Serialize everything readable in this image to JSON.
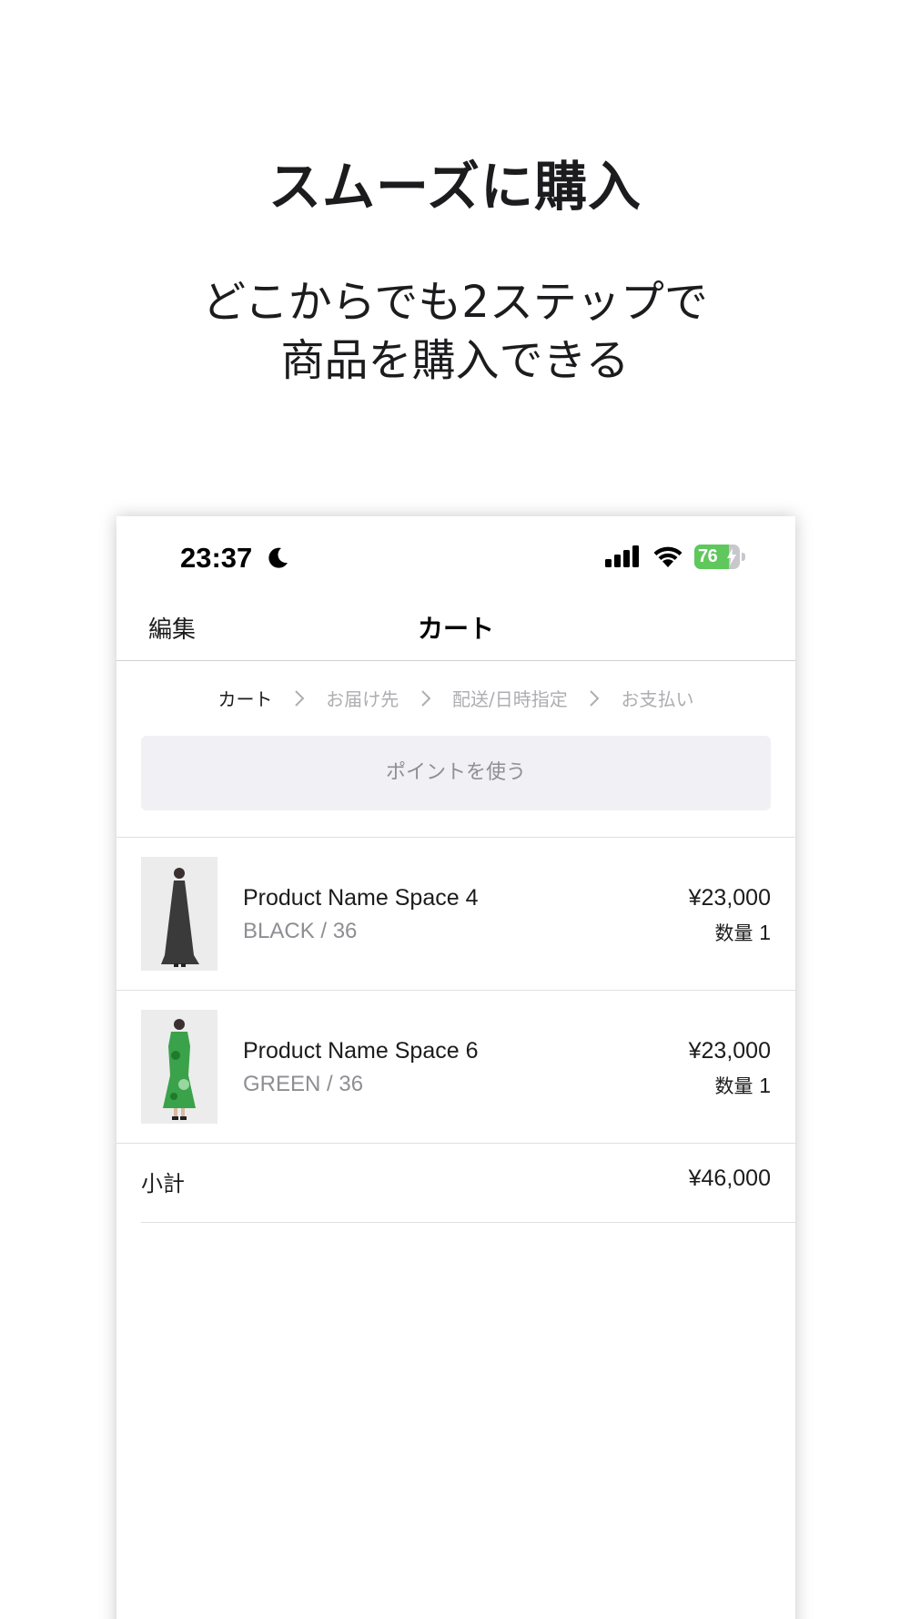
{
  "promo": {
    "title": "スムーズに購入",
    "subtitle_line1": "どこからでも2ステップで",
    "subtitle_line2": "商品を購入できる"
  },
  "status_bar": {
    "time": "23:37",
    "battery_level": "76",
    "battery_fraction": 0.76,
    "battery_color": "#5fc75c",
    "icons": [
      "moon-icon",
      "signal-icon",
      "wifi-icon",
      "battery-icon"
    ]
  },
  "nav": {
    "edit_label": "編集",
    "title": "カート"
  },
  "steps": [
    {
      "label": "カート",
      "active": true
    },
    {
      "label": "お届け先",
      "active": false
    },
    {
      "label": "配送/日時指定",
      "active": false
    },
    {
      "label": "お支払い",
      "active": false
    }
  ],
  "points_button_label": "ポイントを使う",
  "cart_items": [
    {
      "name": "Product Name Space 4",
      "variant": "BLACK / 36",
      "price": "¥23,000",
      "qty_label": "数量",
      "qty": "1",
      "thumb_color": "#3a3a3a"
    },
    {
      "name": "Product Name Space 6",
      "variant": "GREEN / 36",
      "price": "¥23,000",
      "qty_label": "数量",
      "qty": "1",
      "thumb_color": "#3aa24a"
    }
  ],
  "subtotal": {
    "label": "小計",
    "value": "¥46,000"
  }
}
